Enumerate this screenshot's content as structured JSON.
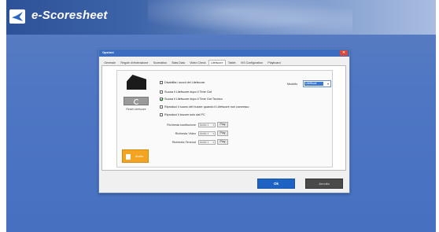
{
  "app": {
    "title": "e-Scoresheet"
  },
  "dialog": {
    "title": "Opzioni",
    "close_glyph": "✕",
    "tabs": [
      {
        "label": "Generale"
      },
      {
        "label": "Regole di federazione"
      },
      {
        "label": "Scoreatixa"
      },
      {
        "label": "Stats Data"
      },
      {
        "label": "Video Check"
      },
      {
        "label": "Litefscore"
      },
      {
        "label": "Tablet"
      },
      {
        "label": "VIS Configuration"
      },
      {
        "label": "Playboard"
      }
    ],
    "active_tab": "Litefscore",
    "reset_label": "Reset Litefscore",
    "orange_button_label": "Audio",
    "model": {
      "label": "Modello",
      "value": "Litefboal"
    },
    "checkboxes": [
      {
        "label": "Disabilita i suoni del Litefscore.",
        "checked": false
      },
      {
        "label": "Suona il Litefscore dopo il Time Out",
        "checked": false
      },
      {
        "label": "Suona il Litefscore dopo il Time Out Tecnico",
        "checked": true
      },
      {
        "label": "Riproduci il suono del buzzer quando il Litefscore non   connesso",
        "checked": false
      },
      {
        "label": "Riproduci il buzzer solo dal PC",
        "checked": false
      }
    ],
    "sounds": [
      {
        "label": "Richiesta sostituzione",
        "value": "Audio 1",
        "play": "Play"
      },
      {
        "label": "Richiesta Video",
        "value": "Audio 1",
        "play": "Play"
      },
      {
        "label": "Richiesta Timeout",
        "value": "Audio 1",
        "play": "Play"
      }
    ],
    "ok_label": "Ok",
    "cancel_label": "Annulla"
  },
  "colors": {
    "accent": "#1e62c4",
    "orange": "#f3a521",
    "background": "#4e76c3"
  }
}
